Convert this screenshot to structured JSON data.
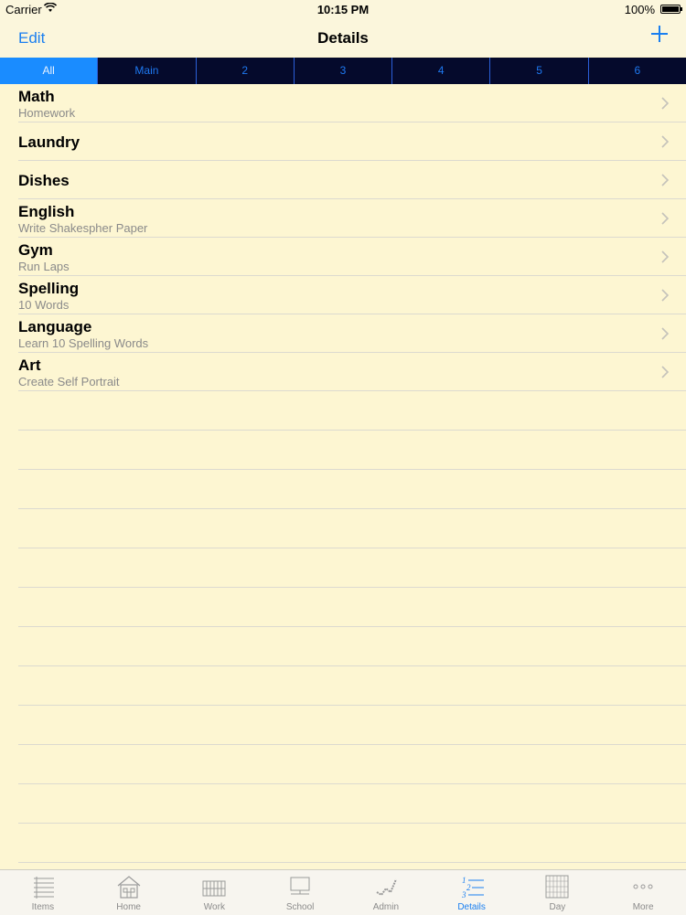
{
  "status": {
    "carrier": "Carrier",
    "time": "10:15 PM",
    "battery": "100%"
  },
  "nav": {
    "edit_label": "Edit",
    "title": "Details"
  },
  "segments": [
    "All",
    "Main",
    "2",
    "3",
    "4",
    "5",
    "6"
  ],
  "active_segment": "All",
  "rows": [
    {
      "title": "Math",
      "subtitle": "Homework"
    },
    {
      "title": "Laundry",
      "subtitle": ""
    },
    {
      "title": "Dishes",
      "subtitle": ""
    },
    {
      "title": "English",
      "subtitle": "Write Shakespher Paper"
    },
    {
      "title": "Gym",
      "subtitle": "Run Laps"
    },
    {
      "title": "Spelling",
      "subtitle": "10 Words"
    },
    {
      "title": "Language",
      "subtitle": "Learn 10 Spelling Words"
    },
    {
      "title": "Art",
      "subtitle": "Create Self Portrait"
    }
  ],
  "tabs": [
    {
      "label": "Items",
      "icon": "list-icon"
    },
    {
      "label": "Home",
      "icon": "house-icon"
    },
    {
      "label": "Work",
      "icon": "grid-icon"
    },
    {
      "label": "School",
      "icon": "board-icon"
    },
    {
      "label": "Admin",
      "icon": "check-chart-icon"
    },
    {
      "label": "Details",
      "icon": "fraction-list-icon"
    },
    {
      "label": "Day",
      "icon": "calendar-icon"
    },
    {
      "label": "More",
      "icon": "more-icon"
    }
  ],
  "active_tab": "Details",
  "colors": {
    "accent": "#1a7ff0",
    "background": "#fdf6d2",
    "segment_bg": "#050a2c",
    "segment_active": "#1a8cff"
  }
}
